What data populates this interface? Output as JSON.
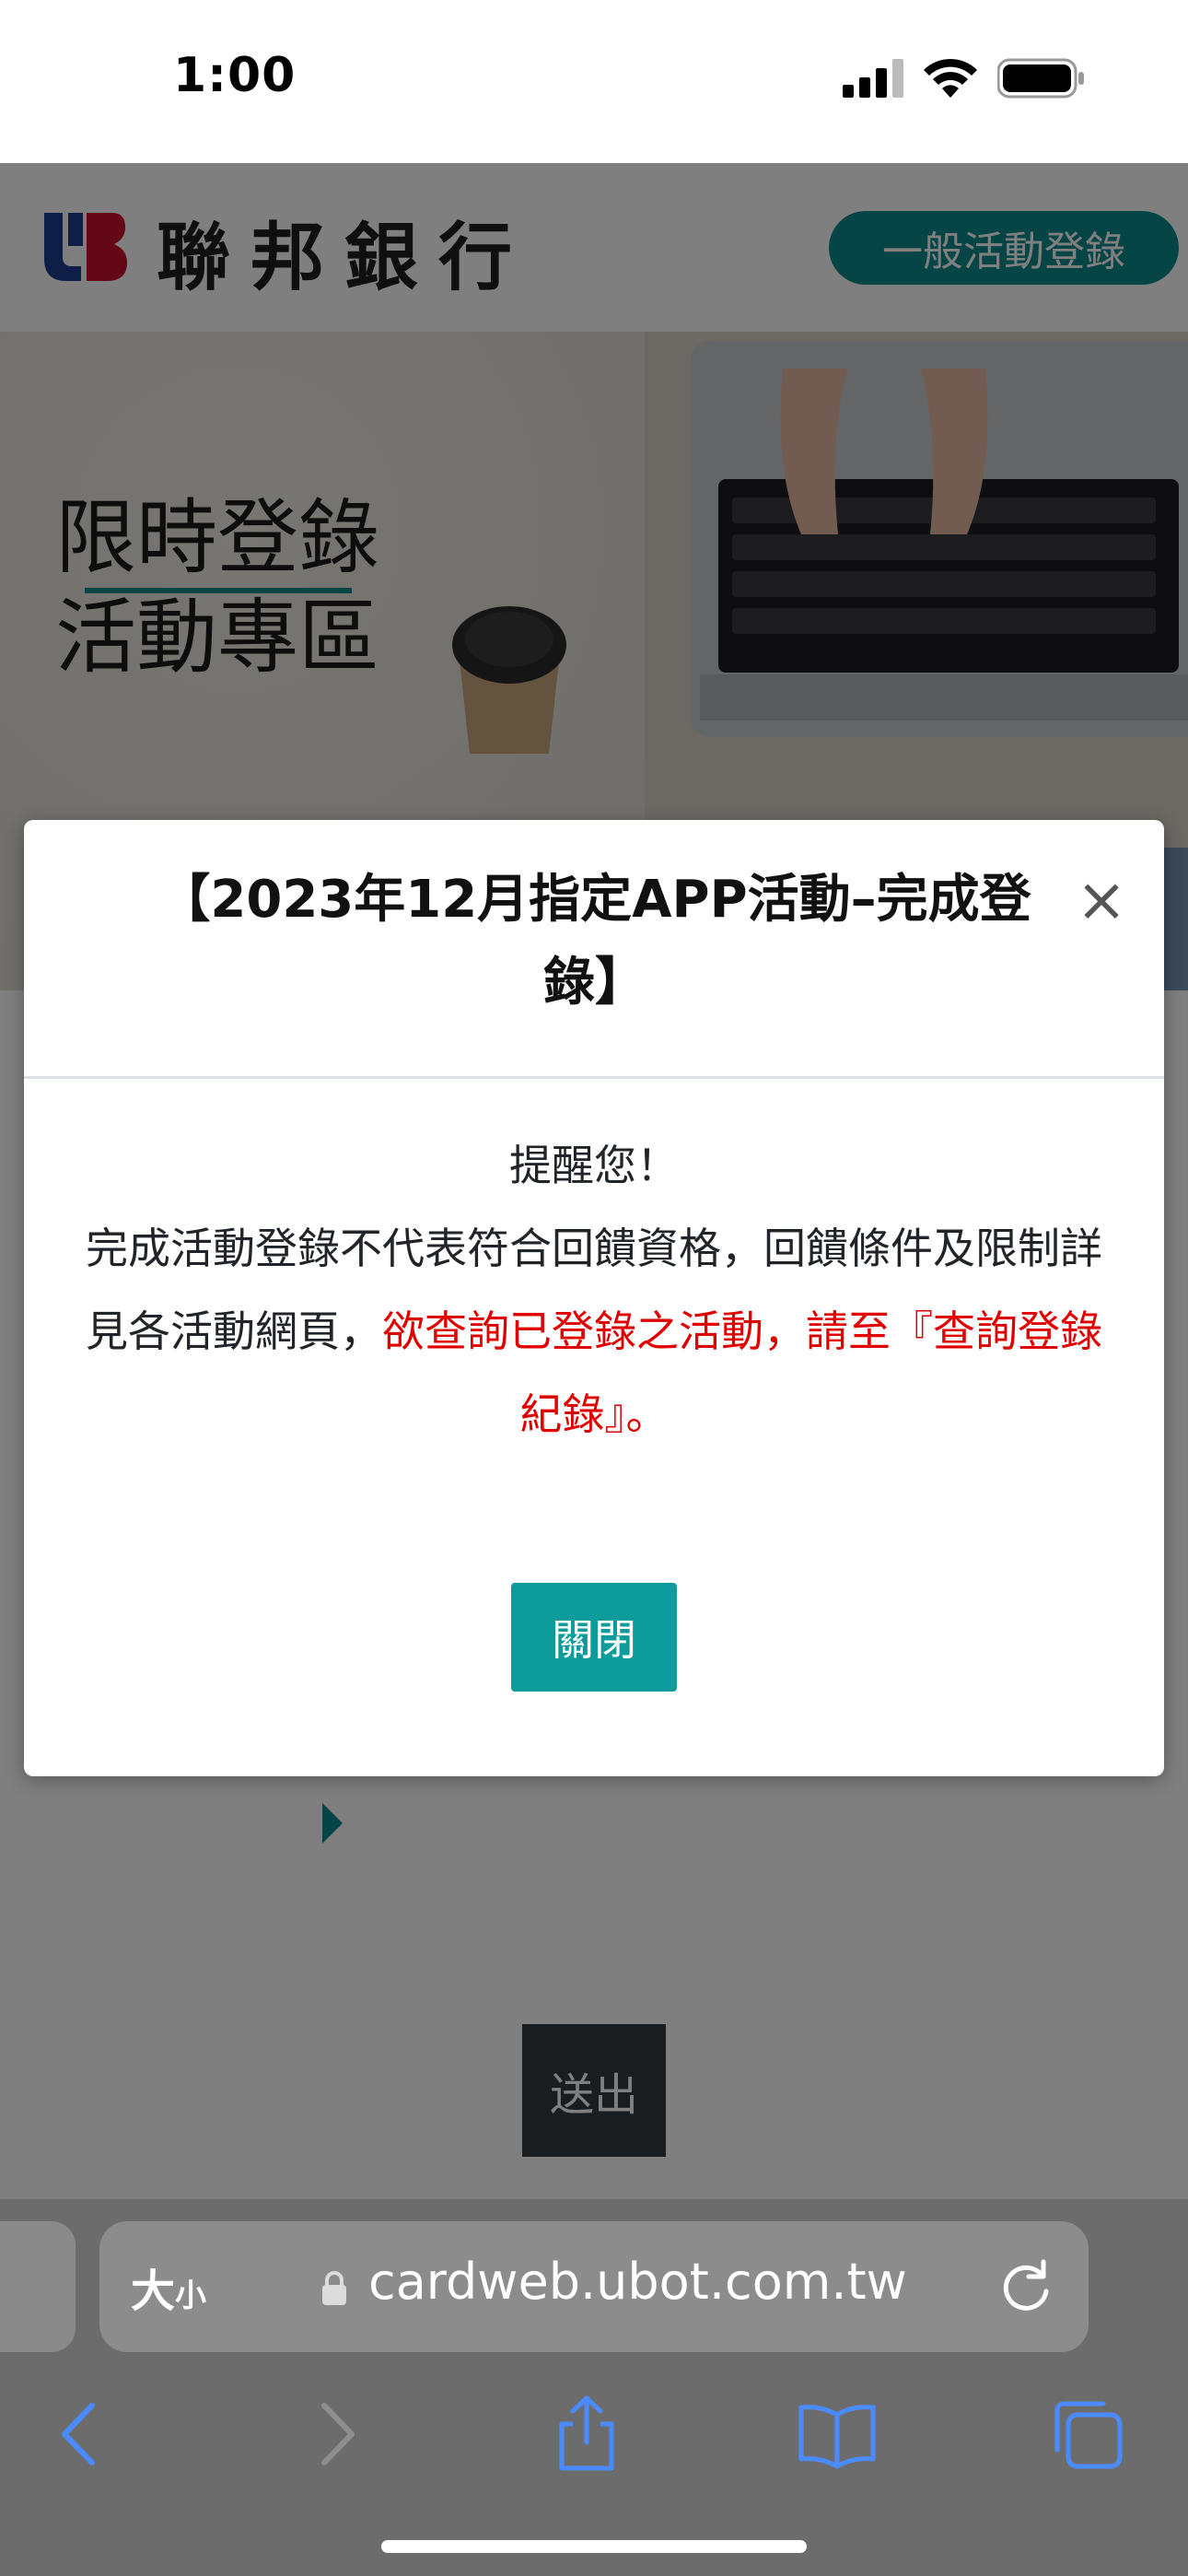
{
  "status_bar": {
    "time": "1:00"
  },
  "site": {
    "bank_name": "聯邦銀行",
    "register_link": "一般活動登錄",
    "hero_title_line1": "限時登錄",
    "hero_title_line2": "活動專區",
    "submit_label": "送出"
  },
  "modal": {
    "title": "【2023年12月指定APP活動–完成登錄】",
    "close_symbol": "×",
    "reminder": "提醒您！",
    "message_normal": "完成活動登錄不代表符合回饋資格，回饋條件及限制詳見各活動網頁，",
    "message_red": "欲查詢已登錄之活動，請至『查詢登錄紀錄』。",
    "close_button": "關閉"
  },
  "browser": {
    "text_size_big": "大",
    "text_size_small": "小",
    "url": "cardweb.ubot.com.tw"
  },
  "colors": {
    "brand_teal": "#0d8a8c",
    "alert_red": "#e00000",
    "submit_dark": "#343a40"
  }
}
